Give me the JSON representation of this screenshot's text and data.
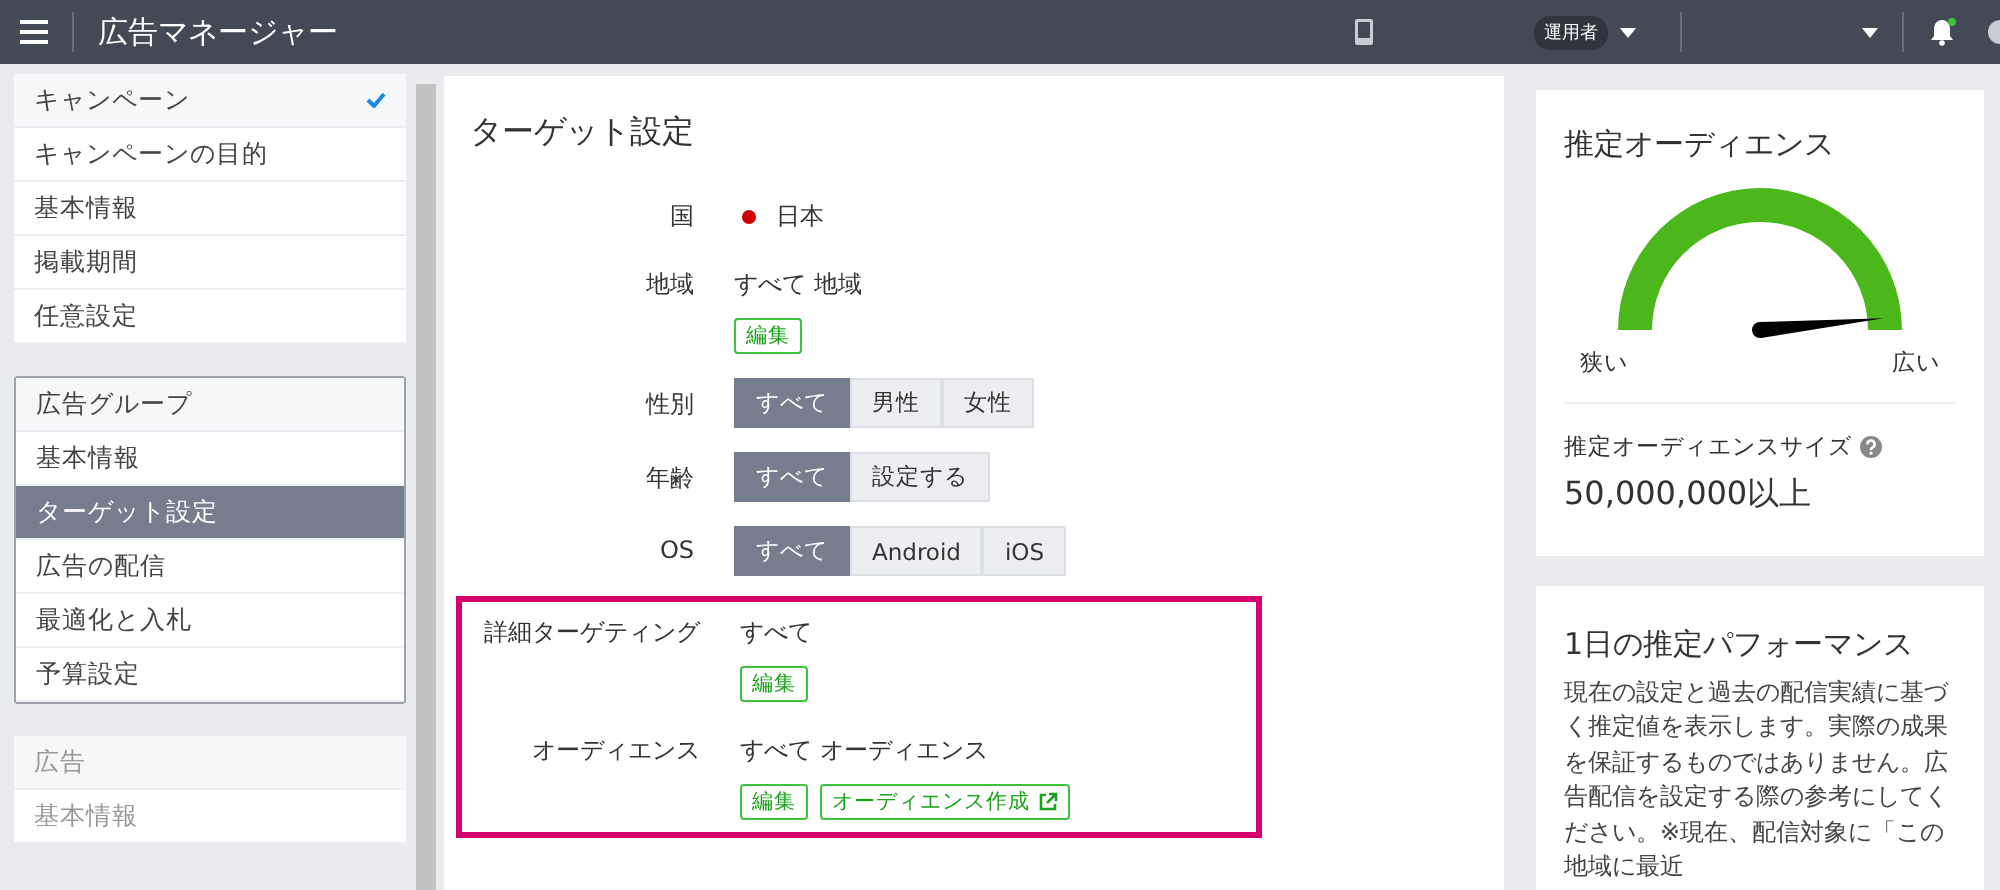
{
  "header": {
    "title": "広告マネージャー",
    "role_badge": "運用者",
    "notification_dot": true
  },
  "sidebar": {
    "sections": [
      {
        "title": "キャンペーン",
        "checked": true,
        "active": false,
        "disabled": false,
        "items": [
          {
            "label": "キャンペーンの目的",
            "selected": false
          },
          {
            "label": "基本情報",
            "selected": false
          },
          {
            "label": "掲載期間",
            "selected": false
          },
          {
            "label": "任意設定",
            "selected": false
          }
        ]
      },
      {
        "title": "広告グループ",
        "checked": false,
        "active": true,
        "disabled": false,
        "items": [
          {
            "label": "基本情報",
            "selected": false
          },
          {
            "label": "ターゲット設定",
            "selected": true
          },
          {
            "label": "広告の配信",
            "selected": false
          },
          {
            "label": "最適化と入札",
            "selected": false
          },
          {
            "label": "予算設定",
            "selected": false
          }
        ]
      },
      {
        "title": "広告",
        "checked": false,
        "active": false,
        "disabled": true,
        "items": [
          {
            "label": "基本情報",
            "selected": false
          }
        ]
      }
    ]
  },
  "form": {
    "title": "ターゲット設定",
    "rows": [
      {
        "kind": "value",
        "label": "国",
        "value": "日本",
        "highlighted": false
      },
      {
        "kind": "edit",
        "label": "地域",
        "value": "すべて 地域",
        "buttons": [
          {
            "label": "編集",
            "external": false
          }
        ],
        "highlighted": false
      },
      {
        "kind": "toggle",
        "label": "性別",
        "options": [
          {
            "label": "すべて",
            "selected": true
          },
          {
            "label": "男性",
            "selected": false
          },
          {
            "label": "女性",
            "selected": false
          }
        ],
        "highlighted": false
      },
      {
        "kind": "toggle",
        "label": "年齢",
        "options": [
          {
            "label": "すべて",
            "selected": true
          },
          {
            "label": "設定する",
            "selected": false
          }
        ],
        "highlighted": false
      },
      {
        "kind": "toggle",
        "label": "OS",
        "options": [
          {
            "label": "すべて",
            "selected": true
          },
          {
            "label": "Android",
            "selected": false
          },
          {
            "label": "iOS",
            "selected": false
          }
        ],
        "highlighted": false
      },
      {
        "kind": "edit",
        "label": "詳細ターゲティング",
        "value": "すべて",
        "buttons": [
          {
            "label": "編集",
            "external": false
          }
        ],
        "highlighted": true
      },
      {
        "kind": "edit",
        "label": "オーディエンス",
        "value": "すべて オーディエンス",
        "buttons": [
          {
            "label": "編集",
            "external": false
          },
          {
            "label": "オーディエンス作成",
            "external": true
          }
        ],
        "highlighted": true
      }
    ]
  },
  "audience_card": {
    "title": "推定オーディエンス",
    "gauge": {
      "min_label": "狭い",
      "max_label": "広い"
    },
    "size_label": "推定オーディエンスサイズ",
    "size_value": "50,000,000以上"
  },
  "performance_card": {
    "title": "1日の推定パフォーマンス",
    "description": "現在の設定と過去の配信実績に基づく推定値を表示します。実際の成果を保証するものではありません。広告配信を設定する際の参考にしてください。※現在、配信対象に「この地域に最近"
  }
}
